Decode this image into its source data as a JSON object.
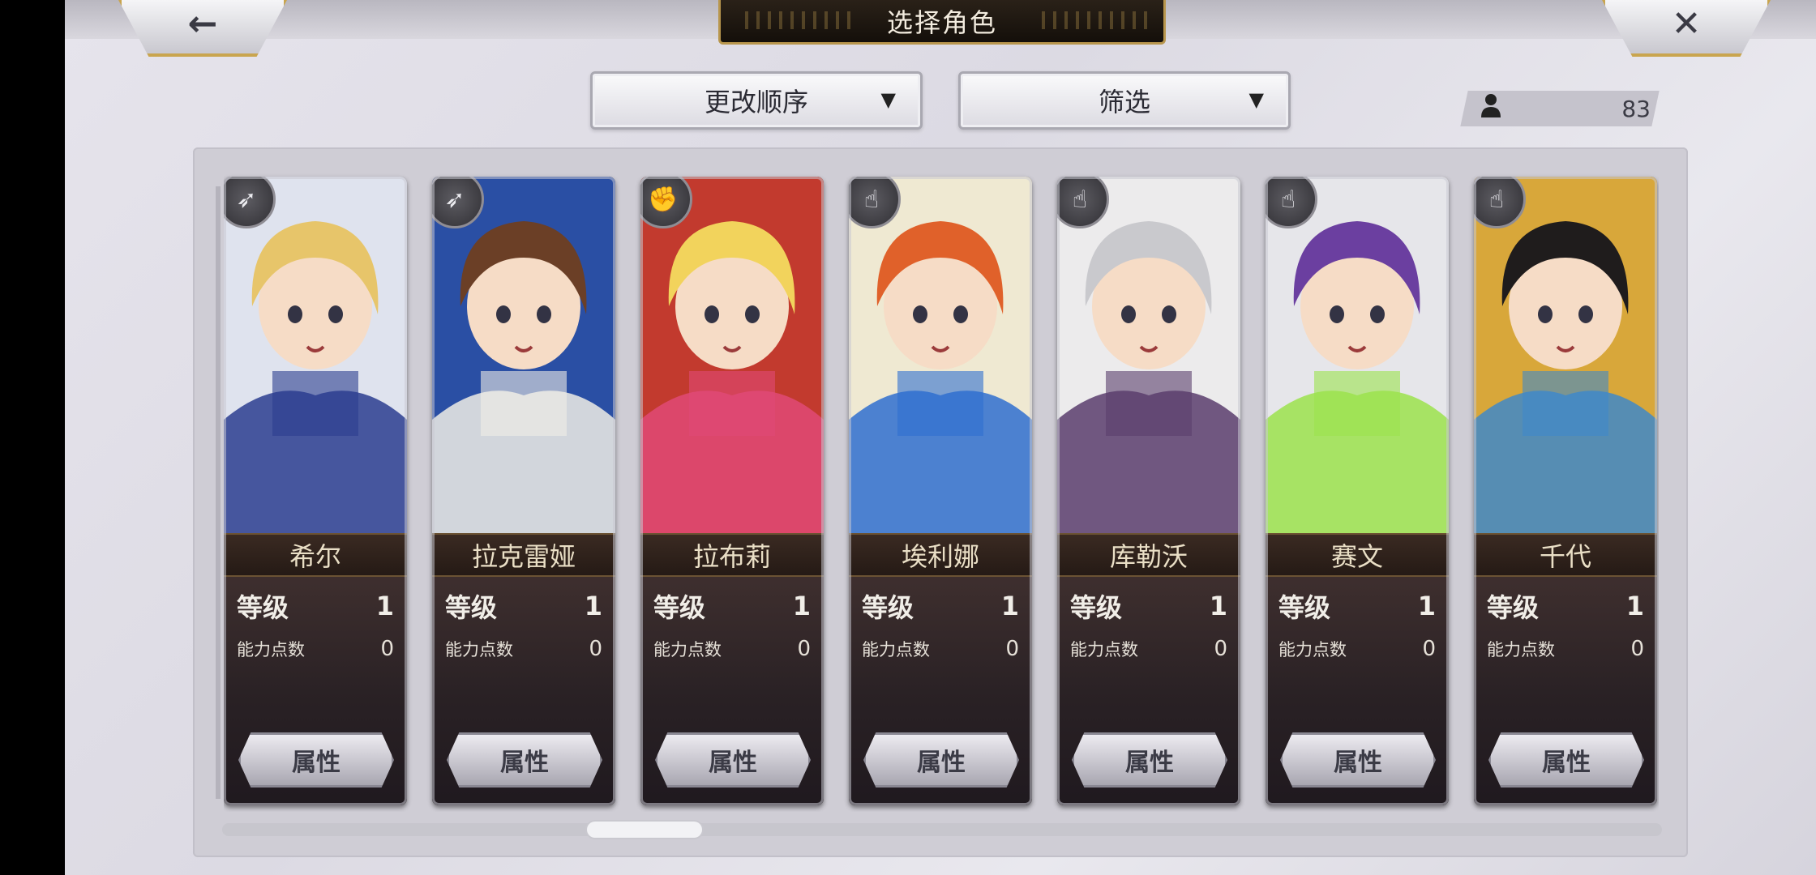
{
  "header": {
    "title": "选择角色",
    "back_icon": "←",
    "close_icon": "✕"
  },
  "controls": {
    "sort_label": "更改顺序",
    "filter_label": "筛选",
    "caret": "▼"
  },
  "roster_count": {
    "icon": "person-icon",
    "value": "83"
  },
  "cards": [
    {
      "name": "希尔",
      "class_icon": "bow",
      "level_label": "等级",
      "level": "1",
      "ap_label": "能力点数",
      "ap": "0",
      "button": "属性",
      "colors": {
        "bg": "#dfe3ee",
        "hair": "#e7c56a",
        "accent": "#2b3d8f"
      }
    },
    {
      "name": "拉克雷娅",
      "class_icon": "bow",
      "level_label": "等级",
      "level": "1",
      "ap_label": "能力点数",
      "ap": "0",
      "button": "属性",
      "colors": {
        "bg": "#2a4fa4",
        "hair": "#6b3f26",
        "accent": "#f0ede6"
      }
    },
    {
      "name": "拉布莉",
      "class_icon": "fist",
      "level_label": "等级",
      "level": "1",
      "ap_label": "能力点数",
      "ap": "0",
      "button": "属性",
      "colors": {
        "bg": "#c23a2e",
        "hair": "#f2d35c",
        "accent": "#e04a76"
      }
    },
    {
      "name": "埃利娜",
      "class_icon": "hand",
      "level_label": "等级",
      "level": "1",
      "ap_label": "能力点数",
      "ap": "0",
      "button": "属性",
      "colors": {
        "bg": "#efe9d2",
        "hair": "#e0612a",
        "accent": "#2f6fd0"
      }
    },
    {
      "name": "库勒沃",
      "class_icon": "hand",
      "level_label": "等级",
      "level": "1",
      "ap_label": "能力点数",
      "ap": "0",
      "button": "属性",
      "colors": {
        "bg": "#ecebec",
        "hair": "#c9c9cd",
        "accent": "#5a3d6d"
      }
    },
    {
      "name": "赛文",
      "class_icon": "hand",
      "level_label": "等级",
      "level": "1",
      "ap_label": "能力点数",
      "ap": "0",
      "button": "属性",
      "colors": {
        "bg": "#e6e6ea",
        "hair": "#6b3fa0",
        "accent": "#9be24c"
      }
    },
    {
      "name": "千代",
      "class_icon": "hand",
      "level_label": "等级",
      "level": "1",
      "ap_label": "能力点数",
      "ap": "0",
      "button": "属性",
      "colors": {
        "bg": "#d8a73a",
        "hair": "#1f1c1c",
        "accent": "#3f88c9"
      }
    }
  ]
}
